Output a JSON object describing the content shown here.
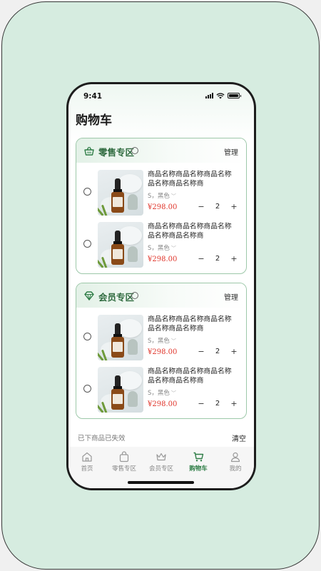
{
  "status_bar": {
    "time": "9:41"
  },
  "page_title": "购物车",
  "sections": [
    {
      "title": "零售专区",
      "icon": "basket-icon",
      "manage_label": "管理",
      "items": [
        {
          "name": "商品名称商品名称商品名称品名称商品名称商",
          "spec": "S，黑色",
          "price": "¥298.00",
          "quantity": "2"
        },
        {
          "name": "商品名称商品名称商品名称品名称商品名称商",
          "spec": "S，黑色",
          "price": "¥298.00",
          "quantity": "2"
        }
      ]
    },
    {
      "title": "会员专区",
      "icon": "diamond-icon",
      "manage_label": "管理",
      "items": [
        {
          "name": "商品名称商品名称商品名称品名称商品名称商",
          "spec": "S，黑色",
          "price": "¥298.00",
          "quantity": "2"
        },
        {
          "name": "商品名称商品名称商品名称品名称商品名称商",
          "spec": "S，黑色",
          "price": "¥298.00",
          "quantity": "2"
        }
      ]
    }
  ],
  "stepper": {
    "minus": "−",
    "plus": "+"
  },
  "invalid": {
    "label": "已下商品已失效",
    "clear_label": "清空"
  },
  "tabbar": [
    {
      "label": "首页",
      "icon": "home-icon"
    },
    {
      "label": "零售专区",
      "icon": "bag-icon"
    },
    {
      "label": "会员专区",
      "icon": "crown-icon"
    },
    {
      "label": "购物车",
      "icon": "cart-icon",
      "active": true
    },
    {
      "label": "我的",
      "icon": "user-icon"
    }
  ],
  "colors": {
    "accent": "#2e7d46",
    "price": "#e0362c",
    "section_border": "#9dc8a9",
    "background": "#d6ece0"
  }
}
